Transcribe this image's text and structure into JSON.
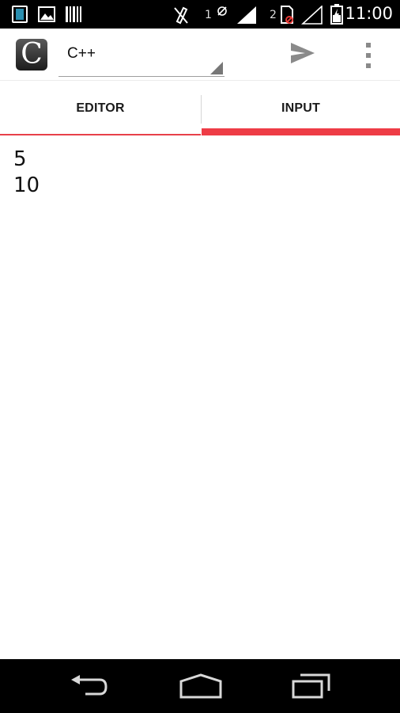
{
  "status_bar": {
    "sim1_label": "1",
    "sim2_label": "2",
    "time": "11:00",
    "icons": [
      "sim-card-icon",
      "image-icon",
      "barcode-icon",
      "vibrate-off-icon",
      "signal-bars-icon",
      "no-sim-icon",
      "signal-empty-icon",
      "battery-charging-icon"
    ]
  },
  "app_bar": {
    "logo_letter": "C",
    "language_selected": "C++",
    "icons": [
      "send-icon",
      "overflow-menu-icon"
    ]
  },
  "tabs": [
    {
      "label": "EDITOR",
      "selected": false
    },
    {
      "label": "INPUT",
      "selected": true
    }
  ],
  "input_area": {
    "lines": [
      "5",
      "10"
    ]
  },
  "nav_bar": {
    "icons": [
      "back-icon",
      "home-icon",
      "recents-icon"
    ]
  },
  "colors": {
    "accent": "#ee3c46",
    "status_bar_bg": "#000000",
    "nav_bar_bg": "#000000",
    "background": "#ffffff"
  }
}
